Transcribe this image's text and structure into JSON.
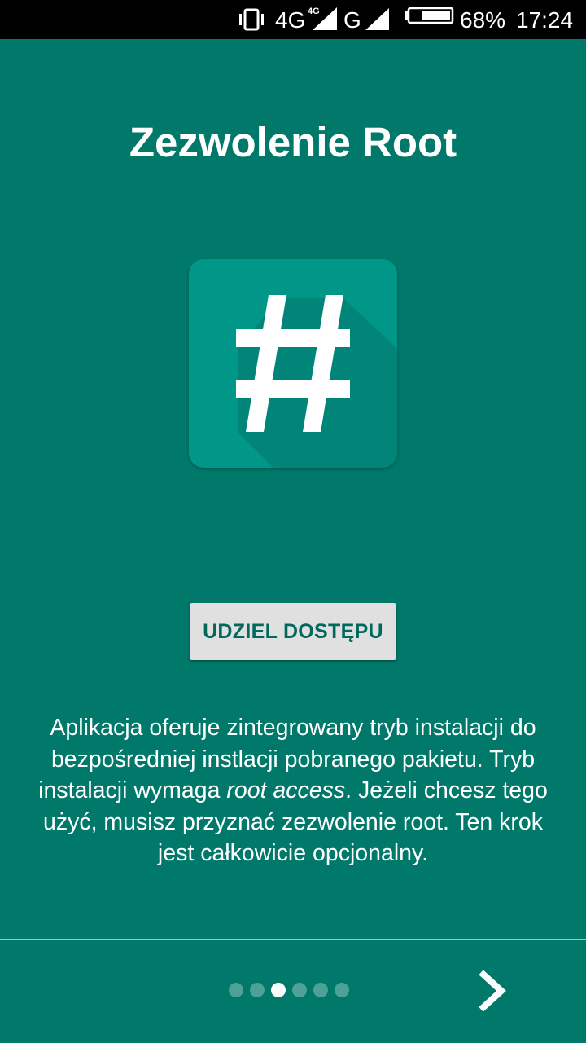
{
  "status_bar": {
    "network_primary": "4G",
    "network_primary_sup": "4G",
    "network_secondary": "G",
    "battery_percent": "68%",
    "time": "17:24",
    "battery_level": 0.68,
    "icons": [
      "vibrate-icon",
      "signal-icon",
      "signal-icon",
      "battery-icon"
    ]
  },
  "page": {
    "title": "Zezwolenie Root",
    "app_icon": "hash-icon",
    "grant_button_label": "UDZIEL DOSTĘPU",
    "description": {
      "before": "Aplikacja oferuje zintegrowany tryb instalacji do bezpośredniej instlacji pobranego pakietu. Tryb instalacji wymaga ",
      "emphasis": "root access",
      "after": ". Jeżeli chcesz tego użyć, musisz przyznać zezwolenie root. Ten krok jest całkowicie opcjonalny."
    }
  },
  "pager": {
    "total": 6,
    "active_index": 2
  },
  "navigation": {
    "next_icon": "chevron-right-icon"
  },
  "colors": {
    "background": "#00796B",
    "icon_background": "#009688",
    "button_background": "#E0E0E0",
    "button_text": "#00695C",
    "status_bar": "#000000"
  }
}
